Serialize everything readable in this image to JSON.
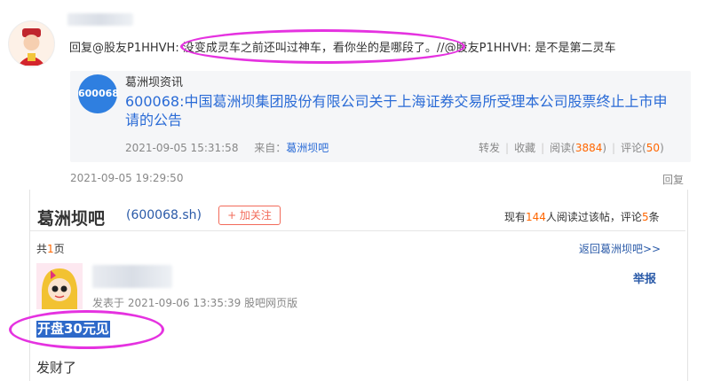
{
  "reply": {
    "reply_prefix": "回复@股友P1HHVH",
    "reply_body": ": 没变成灵车之前还叫过神车，看你坐的是哪段了。//@股友P1HHVH: 是不是第二灵车",
    "time": "2021-09-05 19:29:50",
    "reply_action": "回复"
  },
  "quoted": {
    "source": "葛洲坝资讯",
    "code_badge": "600068",
    "title": "600068:中国葛洲坝集团股份有限公司关于上海证券交易所受理本公司股票终止上市申请的公告",
    "time": "2021-09-05 15:31:58",
    "from_label": "来自：",
    "from_link": "葛洲坝吧",
    "forward": "转发",
    "favorite": "收藏",
    "read_label": "阅读(",
    "read_count": "3884",
    "comment_label": "评论(",
    "comment_count": "50",
    "close_paren": ")"
  },
  "forum": {
    "name": "葛洲坝吧",
    "code": "(600068.sh)",
    "follow": "+ 加关注",
    "stat_prefix": "现有",
    "viewers": "144",
    "stat_mid": "人阅读过该帖，评论",
    "comments": "5",
    "stat_suffix": "条",
    "pages_prefix": "共",
    "pages": "1",
    "pages_suffix": "页",
    "back_link": "返回葛洲坝吧>>"
  },
  "post": {
    "time": "发表于 2021-09-06 13:35:39 股吧网页版",
    "report": "举报",
    "title": "开盘30元见",
    "body": "发财了"
  },
  "colors": {
    "accent": "#2a6bd6",
    "highlight": "#2e69c9",
    "annotation": "#e532e0",
    "count": "#ff6600"
  }
}
